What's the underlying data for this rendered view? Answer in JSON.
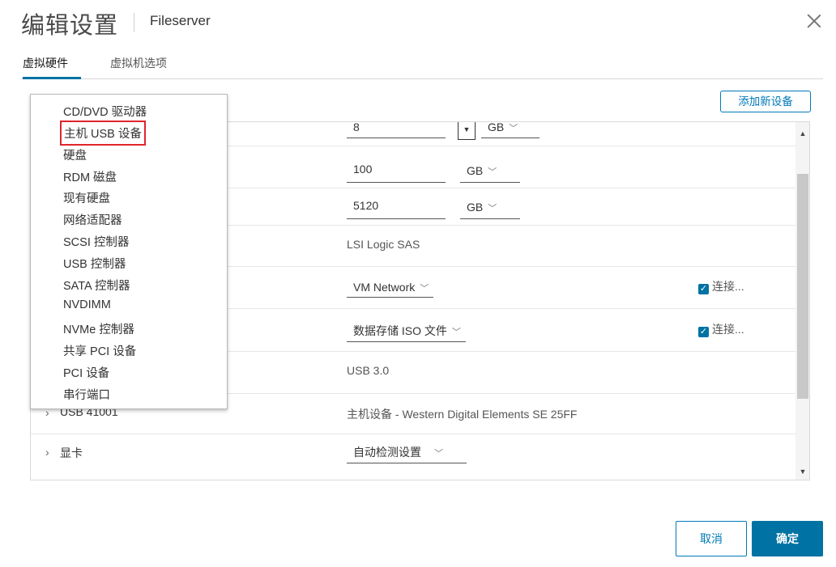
{
  "dialog": {
    "title": "编辑设置",
    "vm_name": "Fileserver"
  },
  "tabs": [
    {
      "label": "虚拟硬件",
      "active": true
    },
    {
      "label": "虚拟机选项",
      "active": false
    }
  ],
  "toolbar": {
    "add_device_label": "添加新设备"
  },
  "rows": {
    "memory": {
      "value": "8",
      "unit": "GB"
    },
    "disk1": {
      "value": "100",
      "unit": "GB"
    },
    "disk2": {
      "value": "5120",
      "unit": "GB"
    },
    "scsi": {
      "value": "LSI Logic SAS"
    },
    "network": {
      "value": "VM Network",
      "connect_label": "连接..."
    },
    "cdrom": {
      "value": "数据存储 ISO 文件",
      "connect_label": "连接..."
    },
    "usb_controller": {
      "value": "USB 3.0"
    },
    "usb_device": {
      "label": "USB 41001",
      "value": "主机设备 - Western Digital Elements SE 25FF"
    },
    "video": {
      "label": "显卡",
      "value": "自动检测设置"
    }
  },
  "add_device_menu": [
    "CD/DVD 驱动器",
    "主机 USB 设备",
    "硬盘",
    "RDM 磁盘",
    "现有硬盘",
    "网络适配器",
    "SCSI 控制器",
    "USB 控制器",
    "SATA 控制器",
    "NVDIMM",
    "NVMe 控制器",
    "共享 PCI 设备",
    "PCI 设备",
    "串行端口"
  ],
  "highlighted_menu_item": "主机 USB 设备",
  "footer": {
    "cancel_label": "取消",
    "ok_label": "确定"
  },
  "colors": {
    "accent": "#0072a3",
    "highlight": "#e0252c"
  }
}
